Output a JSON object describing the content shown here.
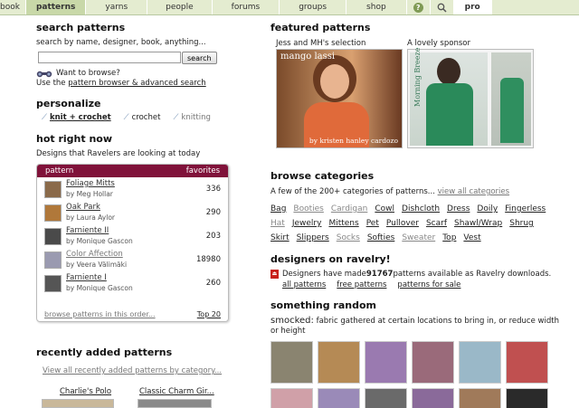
{
  "nav": {
    "tabs": [
      "book",
      "patterns",
      "yarns",
      "people",
      "forums",
      "groups",
      "shop"
    ],
    "pro": "pro"
  },
  "search": {
    "title": "search patterns",
    "desc": "search by name, designer, book, anything...",
    "button": "search",
    "browse_q": "Want to browse?",
    "use_pre": "Use the ",
    "browse_link": "pattern browser & advanced search"
  },
  "personalize": {
    "title": "personalize",
    "opts": [
      "knit + crochet",
      "crochet",
      "knitting"
    ]
  },
  "hot": {
    "title": "hot right now",
    "desc": "Designs that Ravelers are looking at today",
    "col1": "pattern",
    "col2": "favorites",
    "rows": [
      {
        "name": "Foliage Mitts",
        "by": "by Meg Hollar",
        "count": "336",
        "color": "#8a6a4a"
      },
      {
        "name": "Oak Park",
        "by": "by Laura Aylor",
        "count": "290",
        "color": "#b0783a"
      },
      {
        "name": "Farniente II",
        "by": "by Monique Gascon",
        "count": "203",
        "color": "#4a4a4a"
      },
      {
        "name": "Color Affection",
        "by": "by Veera Välimäki",
        "count": "18980",
        "color": "#9a9ab0"
      },
      {
        "name": "Farniente I",
        "by": "by Monique Gascon",
        "count": "260",
        "color": "#555555"
      }
    ],
    "foot_link": "browse patterns in this order...",
    "top": "Top 20"
  },
  "recent": {
    "title": "recently added patterns",
    "link": "View all recently added patterns by category...",
    "items": [
      "Charlie's Polo",
      "Classic Charm Gir..."
    ]
  },
  "featured": {
    "title": "featured patterns",
    "sel_label": "Jess and MH's selection",
    "sponsor_label": "A lovely sponsor",
    "img1_title": "mango lassi",
    "img1_credit": "by kristen hanley cardozo",
    "img2_text": "Morning Breeze"
  },
  "browse": {
    "title": "browse categories",
    "desc_pre": "A few of the 200+ categories of patterns... ",
    "view_all": "view all categories",
    "lines": [
      [
        {
          "t": "Bag",
          "d": false
        },
        {
          "t": "Booties",
          "d": true
        },
        {
          "t": "Cardigan",
          "d": true
        },
        {
          "t": "Cowl",
          "d": false
        },
        {
          "t": "Dishcloth",
          "d": false
        },
        {
          "t": "Dress",
          "d": false
        },
        {
          "t": "Doily",
          "d": false
        },
        {
          "t": "Fingerless",
          "d": false
        }
      ],
      [
        {
          "t": "Hat",
          "d": true
        },
        {
          "t": "Jewelry",
          "d": false
        },
        {
          "t": "Mittens",
          "d": false
        },
        {
          "t": "Pet",
          "d": false
        },
        {
          "t": "Pullover",
          "d": false
        },
        {
          "t": "Scarf",
          "d": false
        },
        {
          "t": "Shawl/Wrap",
          "d": false
        },
        {
          "t": "Shrug",
          "d": false
        }
      ],
      [
        {
          "t": "Skirt",
          "d": false
        },
        {
          "t": "Slippers",
          "d": false
        },
        {
          "t": "Socks",
          "d": true
        },
        {
          "t": "Softies",
          "d": false
        },
        {
          "t": "Sweater",
          "d": true
        },
        {
          "t": "Top",
          "d": false
        },
        {
          "t": "Vest",
          "d": false
        }
      ]
    ]
  },
  "designers": {
    "title": "designers on ravelry!",
    "pre": "Designers have made ",
    "count": "91767",
    "post": " patterns available as Ravelry downloads.",
    "links": [
      "all patterns",
      "free patterns",
      "patterns for sale"
    ]
  },
  "random": {
    "title": "something random",
    "term": "smocked:",
    "def": " fabric gathered at certain locations to bring in, or reduce width or height",
    "colors": [
      "#8a8470",
      "#b58a55",
      "#9a7ab0",
      "#9a6a7a",
      "#9ab8c8",
      "#c05050",
      "#d0a0a8",
      "#9a8ab8",
      "#6a6a6a",
      "#8a6a9a",
      "#a07a5a",
      "#2a2a2a"
    ]
  }
}
